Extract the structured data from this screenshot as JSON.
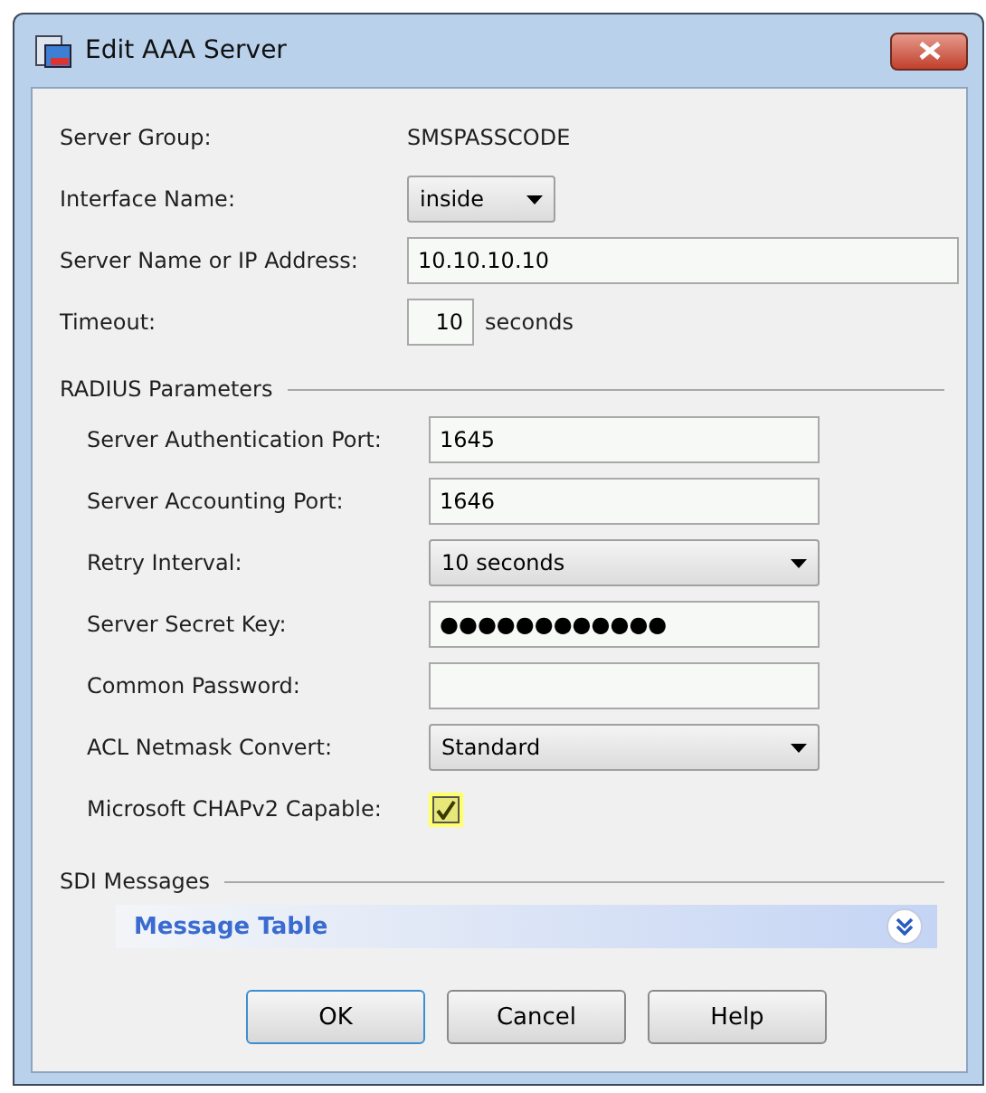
{
  "window": {
    "title": "Edit AAA Server"
  },
  "general": [
    {
      "kind": "static",
      "label": "Server Group:",
      "value": "SMSPASSCODE"
    },
    {
      "kind": "select",
      "label": "Interface Name:",
      "value": "inside"
    },
    {
      "kind": "text",
      "label": "Server Name or IP Address:",
      "value": "10.10.10.10"
    },
    {
      "kind": "number",
      "label": "Timeout:",
      "value": "10",
      "unit": "seconds"
    }
  ],
  "radius": {
    "title": "RADIUS Parameters",
    "fields": [
      {
        "kind": "text",
        "label": "Server Authentication Port:",
        "value": "1645"
      },
      {
        "kind": "text",
        "label": "Server Accounting Port:",
        "value": "1646"
      },
      {
        "kind": "select",
        "label": "Retry Interval:",
        "value": "10 seconds"
      },
      {
        "kind": "text",
        "label": "Server Secret Key:",
        "value": "●●●●●●●●●●●●"
      },
      {
        "kind": "text",
        "label": "Common Password:"
      },
      {
        "kind": "select",
        "label": "ACL Netmask Convert:",
        "value": "Standard"
      },
      {
        "kind": "checkbox",
        "label": "Microsoft CHAPv2 Capable:",
        "checked": true
      }
    ]
  },
  "sdi": {
    "title": "SDI Messages",
    "panel": {
      "title": "Message Table",
      "expanded": false
    }
  },
  "buttons": [
    {
      "label": "OK",
      "default": true
    },
    {
      "label": "Cancel",
      "default": false
    },
    {
      "label": "Help",
      "default": false
    }
  ]
}
